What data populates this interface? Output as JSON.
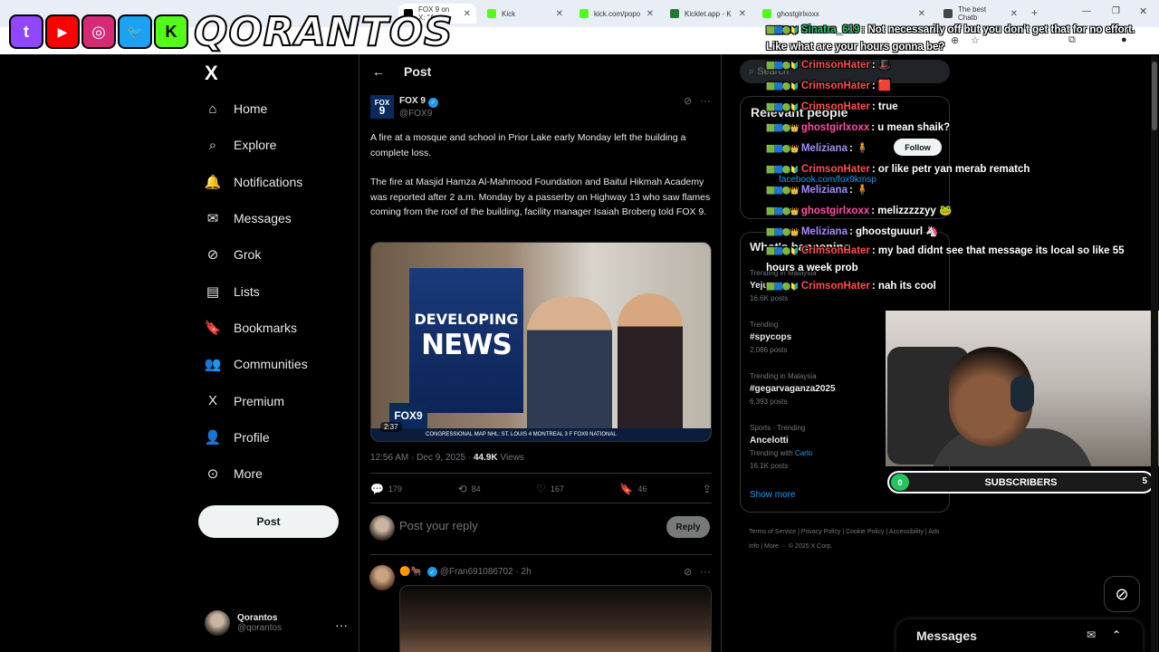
{
  "browser": {
    "tabs": [
      {
        "label": "FOX 9 on X: \"A",
        "favicon_color": "#000000"
      },
      {
        "label": "Kick",
        "favicon_color": "#53fc18"
      },
      {
        "label": "kick.com/popo",
        "favicon_color": "#53fc18"
      },
      {
        "label": "Kicklet.app - K",
        "favicon_color": "#1e7b34"
      },
      {
        "label": "ghostgirlxoxx",
        "favicon_color": "#53fc18"
      },
      {
        "label": "The best Chatb",
        "favicon_color": "#444444"
      }
    ]
  },
  "overlay": {
    "brand": "QORANTOS",
    "socials": [
      {
        "name": "twitch-icon",
        "glyph": "t",
        "color": "#9146ff"
      },
      {
        "name": "youtube-icon",
        "glyph": "▶",
        "color": "#ff0000"
      },
      {
        "name": "instagram-icon",
        "glyph": "◎",
        "color": "#d62976"
      },
      {
        "name": "twitter-icon",
        "glyph": "🐦",
        "color": "#1da1f2"
      },
      {
        "name": "kick-icon",
        "glyph": "K",
        "color": "#53fc18"
      }
    ]
  },
  "nav": {
    "logo": "X",
    "items": [
      {
        "label": "Home",
        "icon": "home-icon",
        "glyph": "⌂"
      },
      {
        "label": "Explore",
        "icon": "search-icon",
        "glyph": "⌕"
      },
      {
        "label": "Notifications",
        "icon": "bell-icon",
        "glyph": "🔔"
      },
      {
        "label": "Messages",
        "icon": "mail-icon",
        "glyph": "✉"
      },
      {
        "label": "Grok",
        "icon": "grok-icon",
        "glyph": "⊘"
      },
      {
        "label": "Lists",
        "icon": "list-icon",
        "glyph": "▤"
      },
      {
        "label": "Bookmarks",
        "icon": "bookmark-icon",
        "glyph": "🔖"
      },
      {
        "label": "Communities",
        "icon": "people-icon",
        "glyph": "👥"
      },
      {
        "label": "Premium",
        "icon": "x-premium-icon",
        "glyph": "X"
      },
      {
        "label": "Profile",
        "icon": "person-icon",
        "glyph": "👤"
      },
      {
        "label": "More",
        "icon": "more-circle-icon",
        "glyph": "⊙"
      }
    ],
    "post_button": "Post",
    "profile": {
      "name": "Qorantos",
      "handle": "@qorantos"
    }
  },
  "post": {
    "header_title": "Post",
    "author_name": "FOX 9",
    "author_handle": "@FOX9",
    "logo_text_top": "FOX",
    "logo_text_bottom": "9",
    "paragraphs": [
      "A fire at a mosque and school in Prior Lake early Monday left the building a complete loss.",
      "The fire at Masjid Hamza Al-Mahmood Foundation and Baitul Hikmah Academy was reported after 2 a.m. Monday by a passerby on Highway 13 who saw flames coming from the roof of the building, facility manager Isaiah Broberg told FOX 9."
    ],
    "media": {
      "headline_top": "DEVELOPING",
      "headline_bottom": "NEWS",
      "station": "FOX9",
      "ticker": "CONGRESSIONAL MAP     NHL: ST. LOUIS 4  MONTREAL 3  F  FOX9  NATIONAL",
      "duration": "2:37"
    },
    "timestamp": "12:56 AM · Dec 9, 2025 · ",
    "views_count": "44.9K",
    "views_label": " Views",
    "stats": {
      "replies": "179",
      "reposts": "84",
      "likes": "167",
      "bookmarks": "46"
    },
    "reply_placeholder": "Post your reply",
    "reply_button": "Reply"
  },
  "reply": {
    "handle": "@Fran691086702 · 2h",
    "emojis": "🟠🐂"
  },
  "sidebar": {
    "search_placeholder": "Search",
    "relevant_title": "Relevant people",
    "follow_button": "Follow",
    "relevant_bio": "facebook.com/fox9kmsp",
    "happening_title": "What's happening",
    "trends": [
      {
        "context": "Trending in Malaysia",
        "title": "Yeju",
        "posts": "16.6K posts"
      },
      {
        "context": "Trending",
        "title": "#spycops",
        "posts": "2,086 posts"
      },
      {
        "context": "Trending in Malaysia",
        "title": "#gegarvaganza2025",
        "posts": "6,393 posts"
      },
      {
        "context": "Sports · Trending",
        "title": "Ancelotti",
        "posts": "16.1K posts",
        "extra_prefix": "Trending with ",
        "extra_link": "Carlo"
      }
    ],
    "show_more": "Show more",
    "footer": "Terms of Service  |  Privacy Policy  |  Cookie Policy  |  Accessibility  |  Ads info  |  More ···  © 2025 X Corp."
  },
  "chat": [
    {
      "user": "Sinatra_619",
      "color": "#2ecc71",
      "text": ": Not necessarily off but you don't get that for no effort. Like what are your hours gonna be?",
      "wrap": true
    },
    {
      "user": "CrimsonHater",
      "color": "#ff4d4d",
      "text": ": 🎩"
    },
    {
      "user": "CrimsonHater",
      "color": "#ff4d4d",
      "text": ": 🟥"
    },
    {
      "user": "CrimsonHater",
      "color": "#ff4d4d",
      "text": ": true"
    },
    {
      "user": "ghostgirlxoxx",
      "color": "#ff4da6",
      "text": ": u mean shaik?"
    },
    {
      "user": "Meliziana",
      "color": "#a78bfa",
      "text": ": 🧍"
    },
    {
      "user": "CrimsonHater",
      "color": "#ff4d4d",
      "text": ": or like petr yan merab rematch"
    },
    {
      "user": "Meliziana",
      "color": "#a78bfa",
      "text": ": 🧍"
    },
    {
      "user": "ghostgirlxoxx",
      "color": "#ff4da6",
      "text": ": melizzzzzyy 🐸"
    },
    {
      "user": "Meliziana",
      "color": "#a78bfa",
      "text": ": ghoostguuurl 🦄"
    },
    {
      "user": "CrimsonHater",
      "color": "#ff4d4d",
      "text": ": my bad didnt see that message its local so like 55 hours a week prob",
      "wrap": true
    },
    {
      "user": "CrimsonHater",
      "color": "#ff4d4d",
      "text": ": nah its cool"
    }
  ],
  "subs": {
    "label": "SUBSCRIBERS",
    "current": "0",
    "goal": "5",
    "progress": 0
  },
  "messages_drawer": {
    "title": "Messages"
  }
}
